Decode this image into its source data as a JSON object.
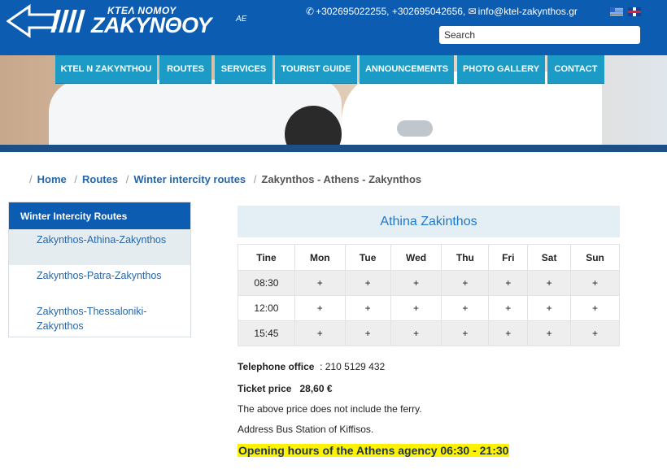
{
  "header": {
    "logo_top": "ΚΤΕΛ ΝΟΜΟΥ",
    "logo_main": "ΖΑΚΥΝΘΟΥ",
    "logo_suffix": "ΑΕ",
    "contact_phones": "+302695022255, +302695042656,",
    "contact_email": "info@ktel-zakynthos.gr",
    "search_placeholder": "Search",
    "brand_color": "#0c5cb2"
  },
  "nav": {
    "items": [
      {
        "label": "KTEL N ZAKYNTHOU"
      },
      {
        "label": "ROUTES"
      },
      {
        "label": "SERVICES"
      },
      {
        "label": "TOURIST GUIDE"
      },
      {
        "label": "ANNOUNCEMENTS"
      },
      {
        "label": "PHOTO GALLERY"
      },
      {
        "label": "CONTACT"
      }
    ],
    "color": "#1c9bc6"
  },
  "breadcrumb": {
    "items": [
      {
        "label": "Home"
      },
      {
        "label": "Routes"
      },
      {
        "label": "Winter intercity routes"
      },
      {
        "label": "Zakynthos - Athens - Zakynthos"
      }
    ]
  },
  "sidebar": {
    "title": "Winter Intercity Routes",
    "items": [
      {
        "label": "Zakynthos-Athina-Zakynthos",
        "active": true
      },
      {
        "label": "Zakynthos-Patra-Zakynthos",
        "active": false
      },
      {
        "label": "Zakynthos-Thessaloniki-Zakynthos",
        "active": false
      }
    ]
  },
  "main": {
    "route_title": "Athina Zakinthos",
    "table": {
      "headers": [
        "Tine",
        "Mon",
        "Tue",
        "Wed",
        "Thu",
        "Fri",
        "Sat",
        "Sun"
      ],
      "rows": [
        [
          "08:30",
          "+",
          "+",
          "+",
          "+",
          "+",
          "+",
          "+"
        ],
        [
          "12:00",
          "+",
          "+",
          "+",
          "+",
          "+",
          "+",
          "+"
        ],
        [
          "15:45",
          "+",
          "+",
          "+",
          "+",
          "+",
          "+",
          "+"
        ]
      ]
    },
    "telephone_label": "Telephone office",
    "telephone_value": ": 210 5129 432",
    "ticket_label": "Ticket price",
    "ticket_value": "28,60 €",
    "ferry_note": "The above price does not include the ferry.",
    "address_note": "Address Bus Station of Kiffisos.",
    "opening_hours": "Opening hours of the Athens agency 06:30 - 21:30",
    "highlight_color": "#fff200"
  }
}
